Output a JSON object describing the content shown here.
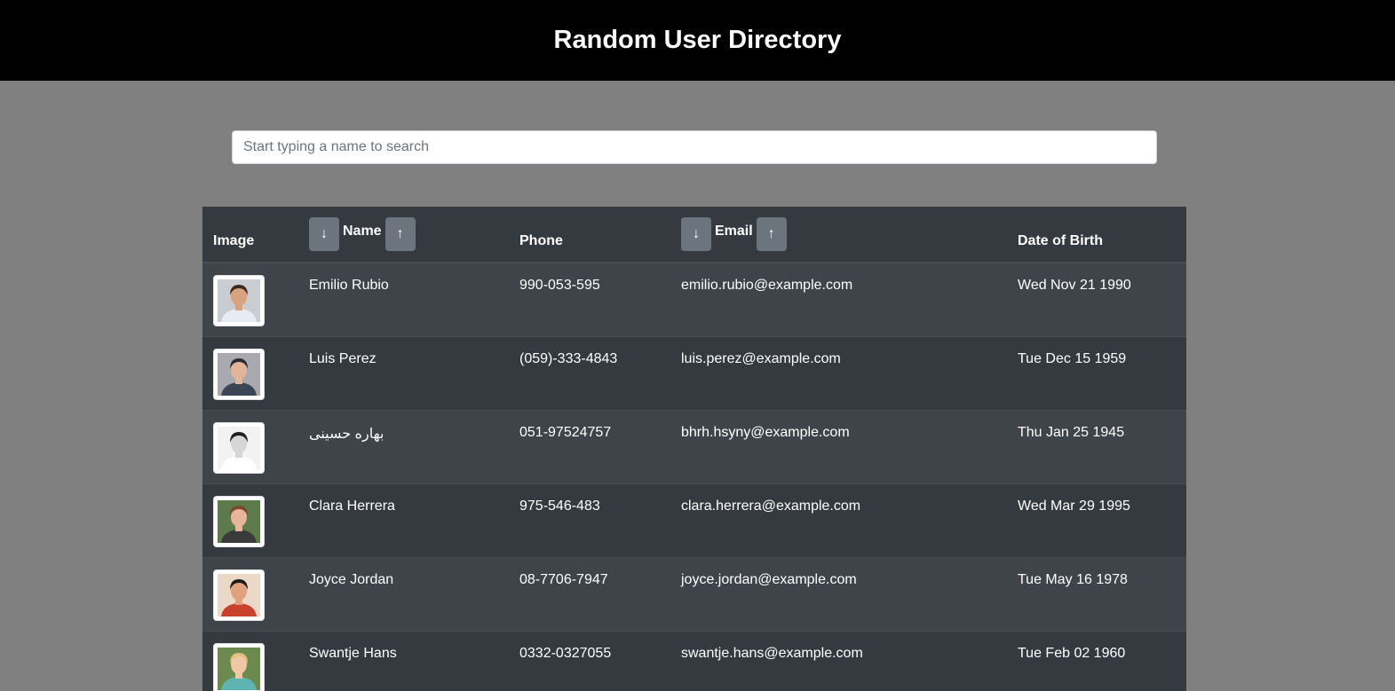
{
  "header": {
    "title": "Random User Directory"
  },
  "search": {
    "placeholder": "Start typing a name to search",
    "value": ""
  },
  "table": {
    "columns": {
      "image": "Image",
      "name": "Name",
      "phone": "Phone",
      "email": "Email",
      "dob": "Date of Birth"
    },
    "sort_buttons": {
      "desc": "↓",
      "asc": "↑"
    },
    "rows": [
      {
        "name": "Emilio Rubio",
        "phone": "990-053-595",
        "email": "emilio.rubio@example.com",
        "dob": "Wed Nov 21 1990",
        "avatar_bg": "#c9ccd1",
        "skin": "#d9a27f",
        "hair": "#3b2b22",
        "shirt": "#e7ecf3"
      },
      {
        "name": "Luis Perez",
        "phone": "(059)-333-4843",
        "email": "luis.perez@example.com",
        "dob": "Tue Dec 15 1959",
        "avatar_bg": "#a8aab0",
        "skin": "#e2b49a",
        "hair": "#2c2c34",
        "shirt": "#3c4556"
      },
      {
        "name": "بهاره حسینی",
        "phone": "051-97524757",
        "email": "bhrh.hsyny@example.com",
        "dob": "Thu Jan 25 1945",
        "avatar_bg": "#f2f2f2",
        "skin": "#d6d6d6",
        "hair": "#1f1f1f",
        "shirt": "#ffffff"
      },
      {
        "name": "Clara Herrera",
        "phone": "975-546-483",
        "email": "clara.herrera@example.com",
        "dob": "Wed Mar 29 1995",
        "avatar_bg": "#5c7a4a",
        "skin": "#e8b49b",
        "hair": "#7a4a2e",
        "shirt": "#3a3a3a"
      },
      {
        "name": "Joyce Jordan",
        "phone": "08-7706-7947",
        "email": "joyce.jordan@example.com",
        "dob": "Tue May 16 1978",
        "avatar_bg": "#e9d9c6",
        "skin": "#e0a27e",
        "hair": "#1e1a18",
        "shirt": "#c8402e"
      },
      {
        "name": "Swantje Hans",
        "phone": "0332-0327055",
        "email": "swantje.hans@example.com",
        "dob": "Tue Feb 02 1960",
        "avatar_bg": "#6c8a4e",
        "skin": "#f0c8a6",
        "hair": "#e2c27a",
        "shirt": "#5fb3b0"
      }
    ]
  }
}
